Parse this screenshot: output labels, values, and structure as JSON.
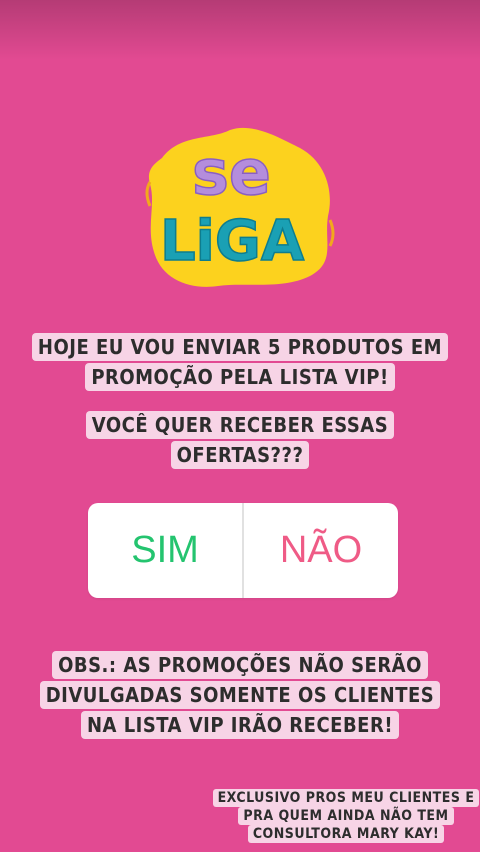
{
  "sticker": {
    "line1": "se",
    "line2": "LiGA"
  },
  "headline": {
    "lines": [
      "HOJE EU VOU ENVIAR 5 PRODUTOS EM",
      "PROMOÇÃO PELA LISTA VIP!"
    ]
  },
  "question": {
    "lines": [
      "VOCÊ QUER RECEBER ESSAS",
      "OFERTAS???"
    ]
  },
  "poll": {
    "option_yes": "SIM",
    "option_no": "NÃO"
  },
  "note": {
    "lines": [
      "OBS.: AS PROMOÇÕES NÃO SERÃO",
      "DIVULGADAS SOMENTE OS CLIENTES",
      "NA LISTA VIP IRÃO RECEBER!"
    ]
  },
  "footer": {
    "lines": [
      "EXCLUSIVO PROS MEU CLIENTES E",
      "PRA QUEM AINDA NÃO TEM",
      "CONSULTORA MARY KAY!"
    ]
  },
  "colors": {
    "background": "#e24a92",
    "highlight": "#f7d4e6",
    "sticker_yellow": "#fcd21e",
    "sticker_purple": "#b48ddc",
    "sticker_teal": "#1aa0b4",
    "yes": "#24c46f",
    "no": "#ef5b86"
  }
}
